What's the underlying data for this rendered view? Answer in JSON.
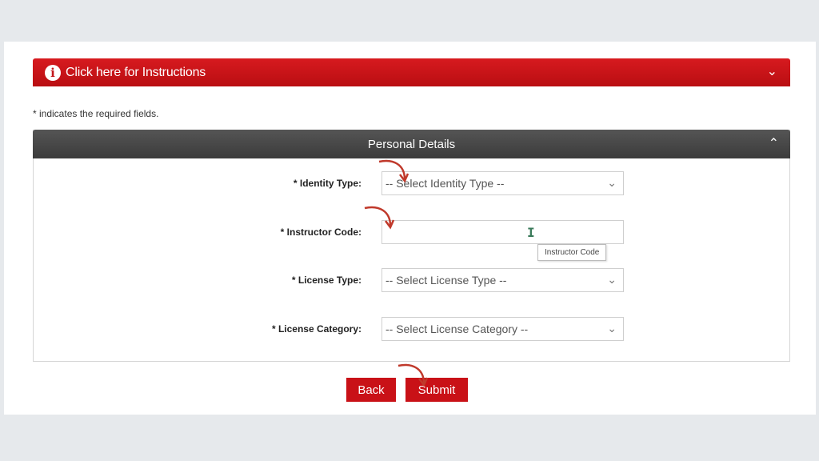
{
  "instructions": {
    "label": "Click here for Instructions",
    "info_glyph": "i",
    "chevron": "⌄"
  },
  "required_note": "* indicates the required fields.",
  "panel": {
    "title": "Personal Details",
    "chevron": "⌃",
    "fields": {
      "identity_type": {
        "label": "* Identity Type:",
        "value": "-- Select Identity Type --"
      },
      "instructor_code": {
        "label": "* Instructor Code:",
        "value": "",
        "tooltip": "Instructor Code"
      },
      "license_type": {
        "label": "* License Type:",
        "value": "-- Select License Type --"
      },
      "license_category": {
        "label": "* License Category:",
        "value": "-- Select License Category --"
      }
    }
  },
  "buttons": {
    "back": "Back",
    "submit": "Submit"
  },
  "colors": {
    "brand_red": "#c91117",
    "header_dark": "#444444",
    "annotation_arrow": "#c0392b"
  },
  "icons": {
    "select_chevron": "⌄",
    "text_caret": "I"
  }
}
